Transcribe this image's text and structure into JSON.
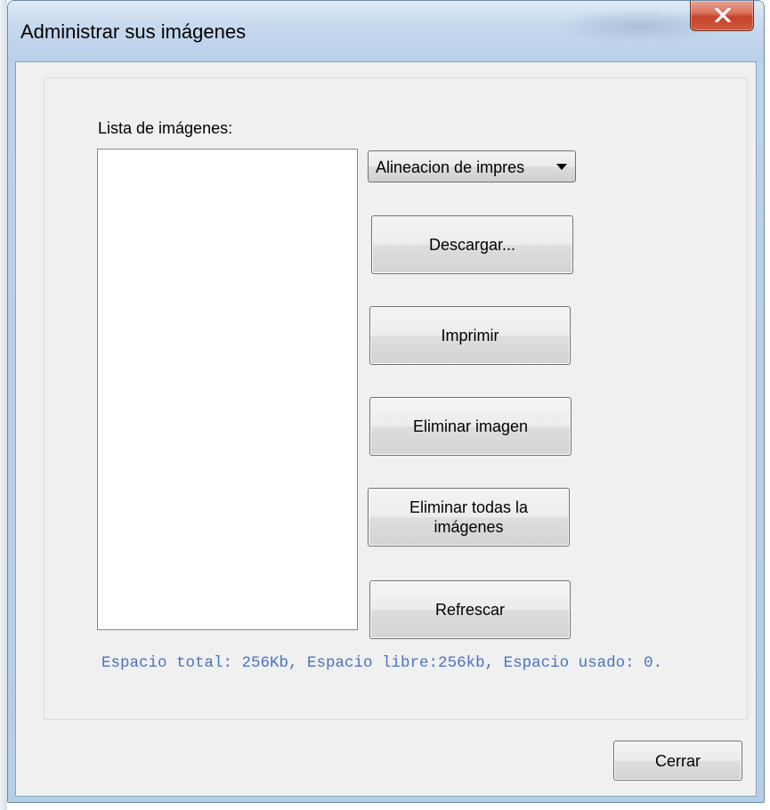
{
  "window": {
    "title": "Administrar sus imágenes",
    "close_icon": "close-x-icon",
    "accent_close": "#c4432a"
  },
  "dialog": {
    "list_label": "Lista de imágenes:",
    "list_items": [],
    "alignment_select": {
      "selected": "Alineacion de impres",
      "icon": "chevron-down-icon"
    },
    "buttons": {
      "download": "Descargar...",
      "print": "Imprimir",
      "delete_image": "Eliminar imagen",
      "delete_all_line1": "Eliminar todas la",
      "delete_all_line2": "imágenes",
      "refresh": "Refrescar",
      "close": "Cerrar"
    },
    "status_text": "Espacio total: 256Kb, Espacio libre:256kb, Espacio usado: 0.",
    "status_color": "#4a72c2"
  }
}
